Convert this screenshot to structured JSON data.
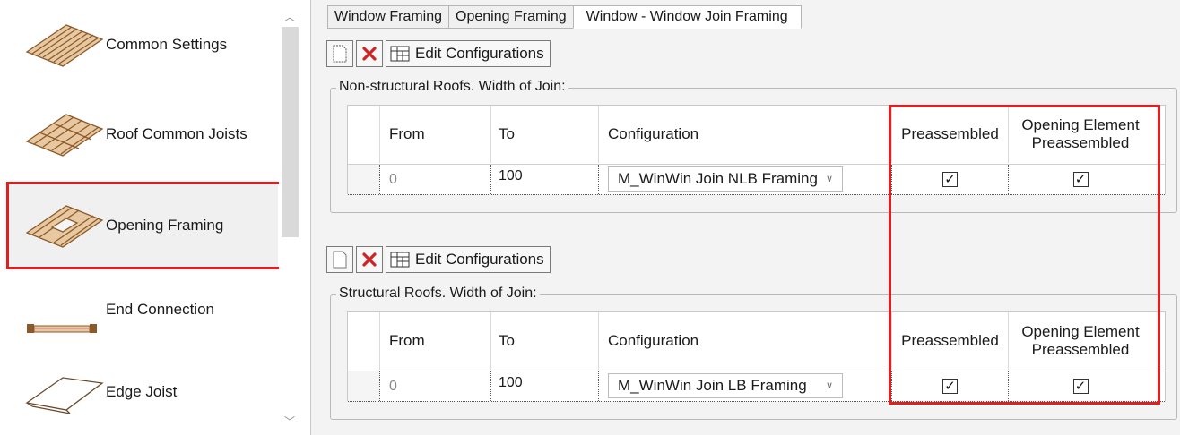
{
  "sidebar": {
    "items": [
      {
        "label": "Common Settings",
        "icon": "joist-panel-icon"
      },
      {
        "label": "Roof Common Joists",
        "icon": "roof-joists-icon"
      },
      {
        "label": "Opening Framing",
        "icon": "opening-framing-icon",
        "selected": true
      },
      {
        "label": "End Connection",
        "icon": "end-connection-icon"
      },
      {
        "label": "Edge Joist",
        "icon": "edge-joist-icon"
      }
    ]
  },
  "tabs": [
    {
      "label": "Window Framing"
    },
    {
      "label": "Opening Framing"
    },
    {
      "label": "Window - Window Join Framing",
      "active": true
    }
  ],
  "toolbar": {
    "edit_label": "Edit Configurations"
  },
  "groups": [
    {
      "title": "Non-structural Roofs. Width of Join:",
      "columns": [
        "From",
        "To",
        "Configuration",
        "Preassembled",
        "Opening Element Preassembled"
      ],
      "rows": [
        {
          "from": "0",
          "to": "100",
          "configuration": "M_WinWin Join NLB Framing",
          "preassembled": true,
          "opening_preassembled": true
        }
      ]
    },
    {
      "title": "Structural Roofs. Width of Join:",
      "columns": [
        "From",
        "To",
        "Configuration",
        "Preassembled",
        "Opening Element Preassembled"
      ],
      "rows": [
        {
          "from": "0",
          "to": "100",
          "configuration": "M_WinWin Join LB Framing",
          "preassembled": true,
          "opening_preassembled": true
        }
      ]
    }
  ],
  "colors": {
    "highlight": "#e02020",
    "delete": "#d42020"
  }
}
